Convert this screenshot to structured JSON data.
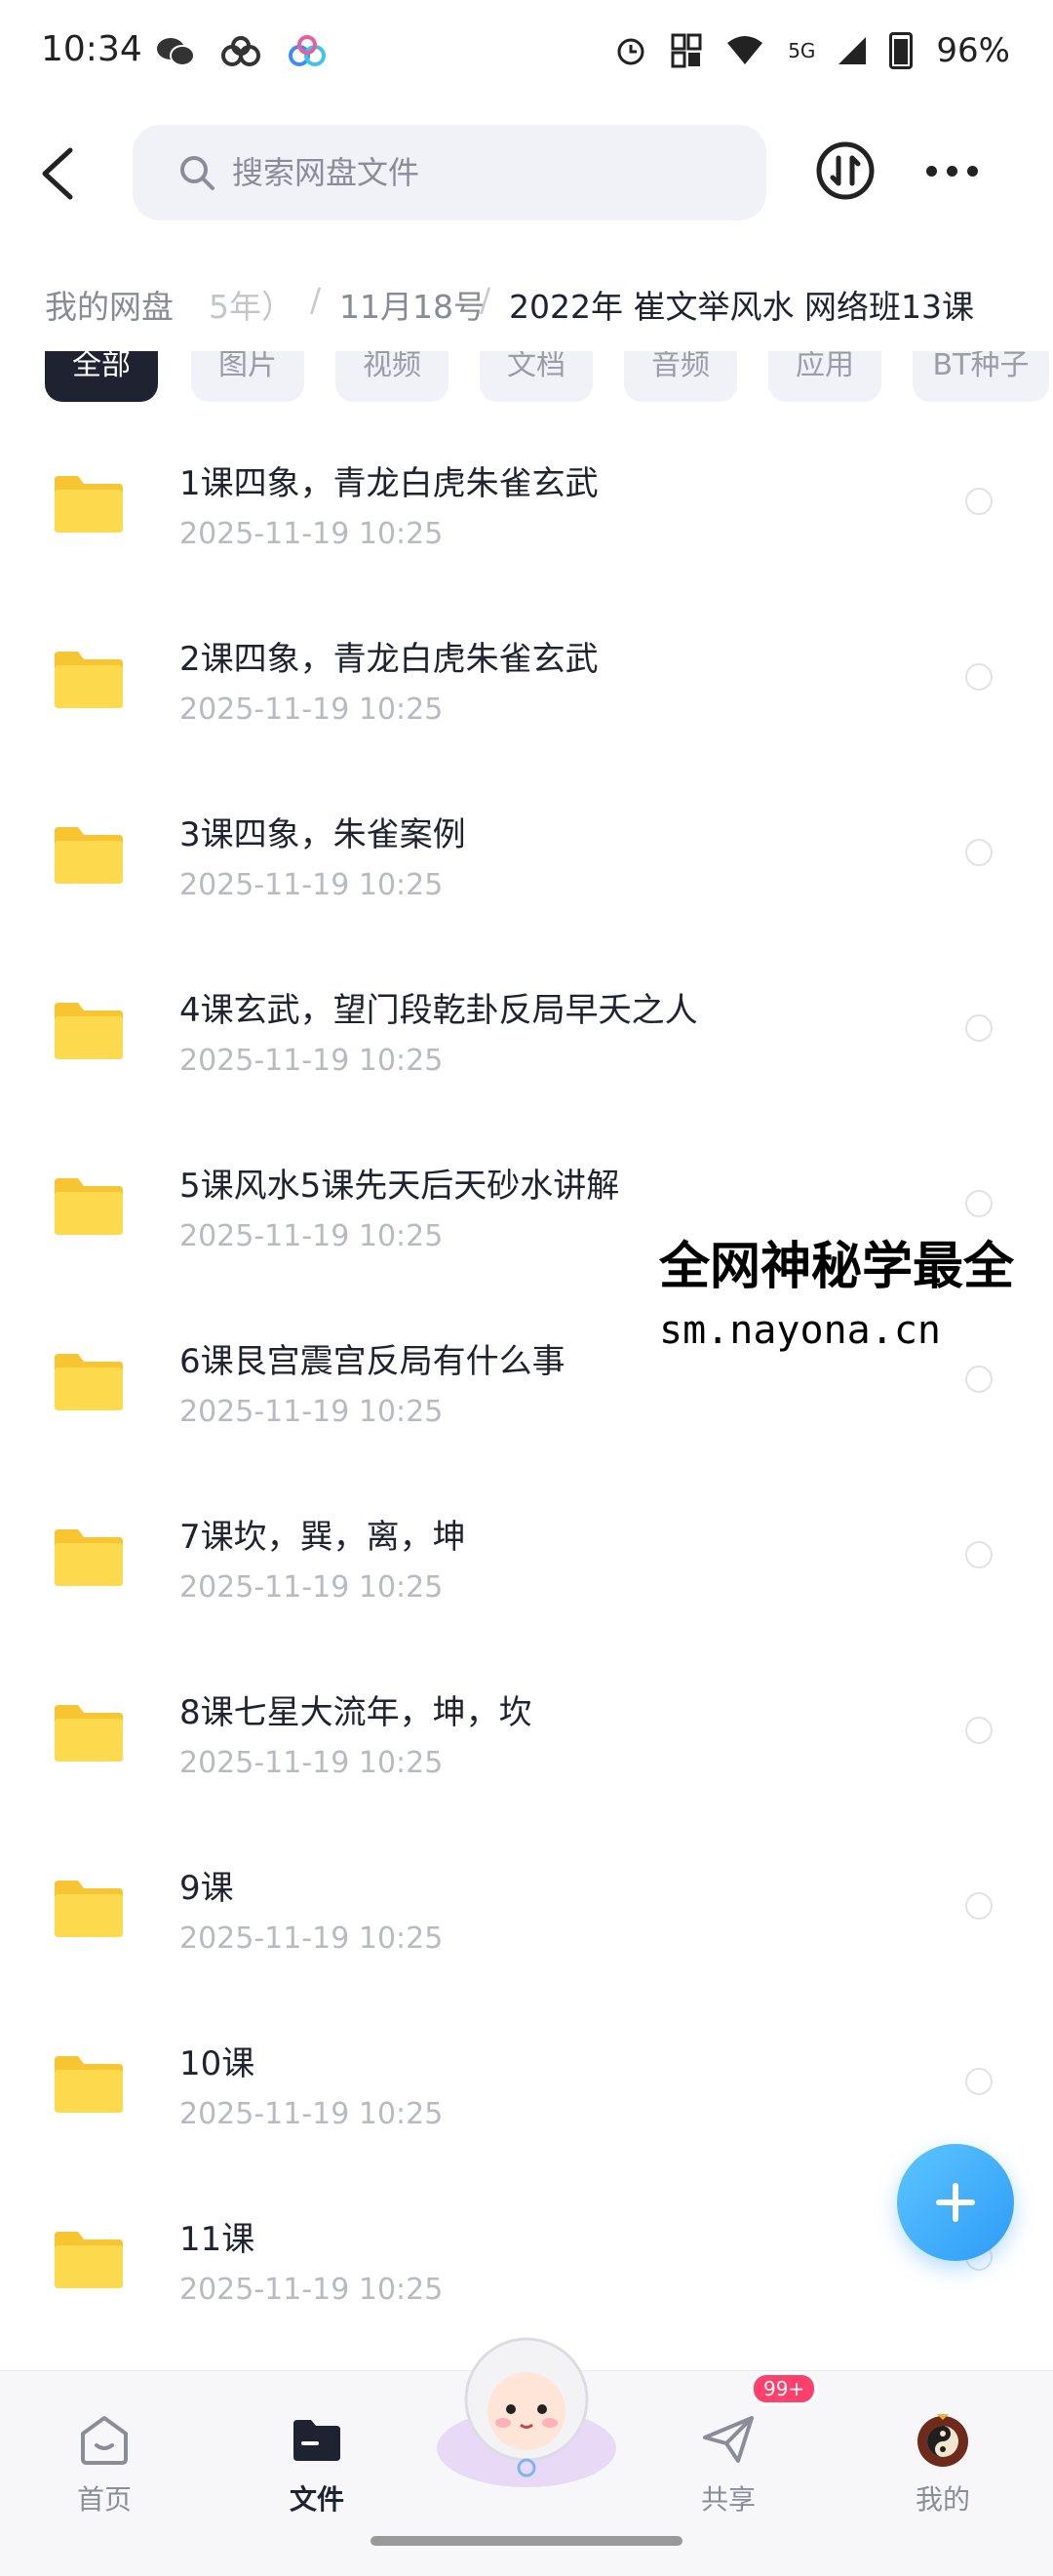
{
  "status_bar": {
    "time": "10:34",
    "network": "5G",
    "battery": "96%",
    "left_icons": [
      "wechat-icon",
      "cloud-link-icon",
      "baidu-netdisk-icon"
    ],
    "right_icons": [
      "alarm-icon",
      "nfc-icon",
      "wifi-icon",
      "signal-icon",
      "battery-icon"
    ]
  },
  "header": {
    "search_placeholder": "搜索网盘文件"
  },
  "breadcrumb": {
    "root": "我的网盘",
    "faded": "5年）",
    "separator": "/",
    "date_folder": "11月18号",
    "current": "2022年 崔文举风水 网络班13课"
  },
  "tabs": [
    {
      "label": "全部",
      "active": true
    },
    {
      "label": "图片",
      "active": false
    },
    {
      "label": "视频",
      "active": false
    },
    {
      "label": "文档",
      "active": false
    },
    {
      "label": "音频",
      "active": false
    },
    {
      "label": "应用",
      "active": false
    },
    {
      "label": "BT种子",
      "active": false
    }
  ],
  "files": [
    {
      "name": "1课四象，青龙白虎朱雀玄武",
      "date": "2025-11-19  10:25"
    },
    {
      "name": "2课四象，青龙白虎朱雀玄武",
      "date": "2025-11-19  10:25"
    },
    {
      "name": "3课四象，朱雀案例",
      "date": "2025-11-19  10:25"
    },
    {
      "name": "4课玄武，望门段乾卦反局早夭之人",
      "date": "2025-11-19  10:25"
    },
    {
      "name": "5课风水5课先天后天砂水讲解",
      "date": "2025-11-19  10:25"
    },
    {
      "name": "6课艮宫震宫反局有什么事",
      "date": "2025-11-19  10:25"
    },
    {
      "name": "7课坎，巽，离，坤",
      "date": "2025-11-19  10:25"
    },
    {
      "name": "8课七星大流年，坤，坎",
      "date": "2025-11-19  10:25"
    },
    {
      "name": "9课",
      "date": "2025-11-19  10:25"
    },
    {
      "name": "10课",
      "date": "2025-11-19  10:25"
    },
    {
      "name": "11课",
      "date": "2025-11-19  10:25"
    }
  ],
  "watermark": {
    "line1": "全网神秘学最全",
    "line2": "sm.nayona.cn"
  },
  "bottom_nav": {
    "items": [
      {
        "label": "首页",
        "icon": "home-icon"
      },
      {
        "label": "文件",
        "icon": "folder-icon",
        "active": true
      },
      {
        "label": "共享",
        "icon": "paper-plane-icon"
      },
      {
        "label": "我的",
        "icon": "yin-yang-avatar-icon"
      }
    ],
    "share_badge": "99+"
  },
  "colors": {
    "accent": "#2e9bf7",
    "folder": "#f9cf3b",
    "tab_active": "#1f2230",
    "badge": "#ff3f6c"
  }
}
